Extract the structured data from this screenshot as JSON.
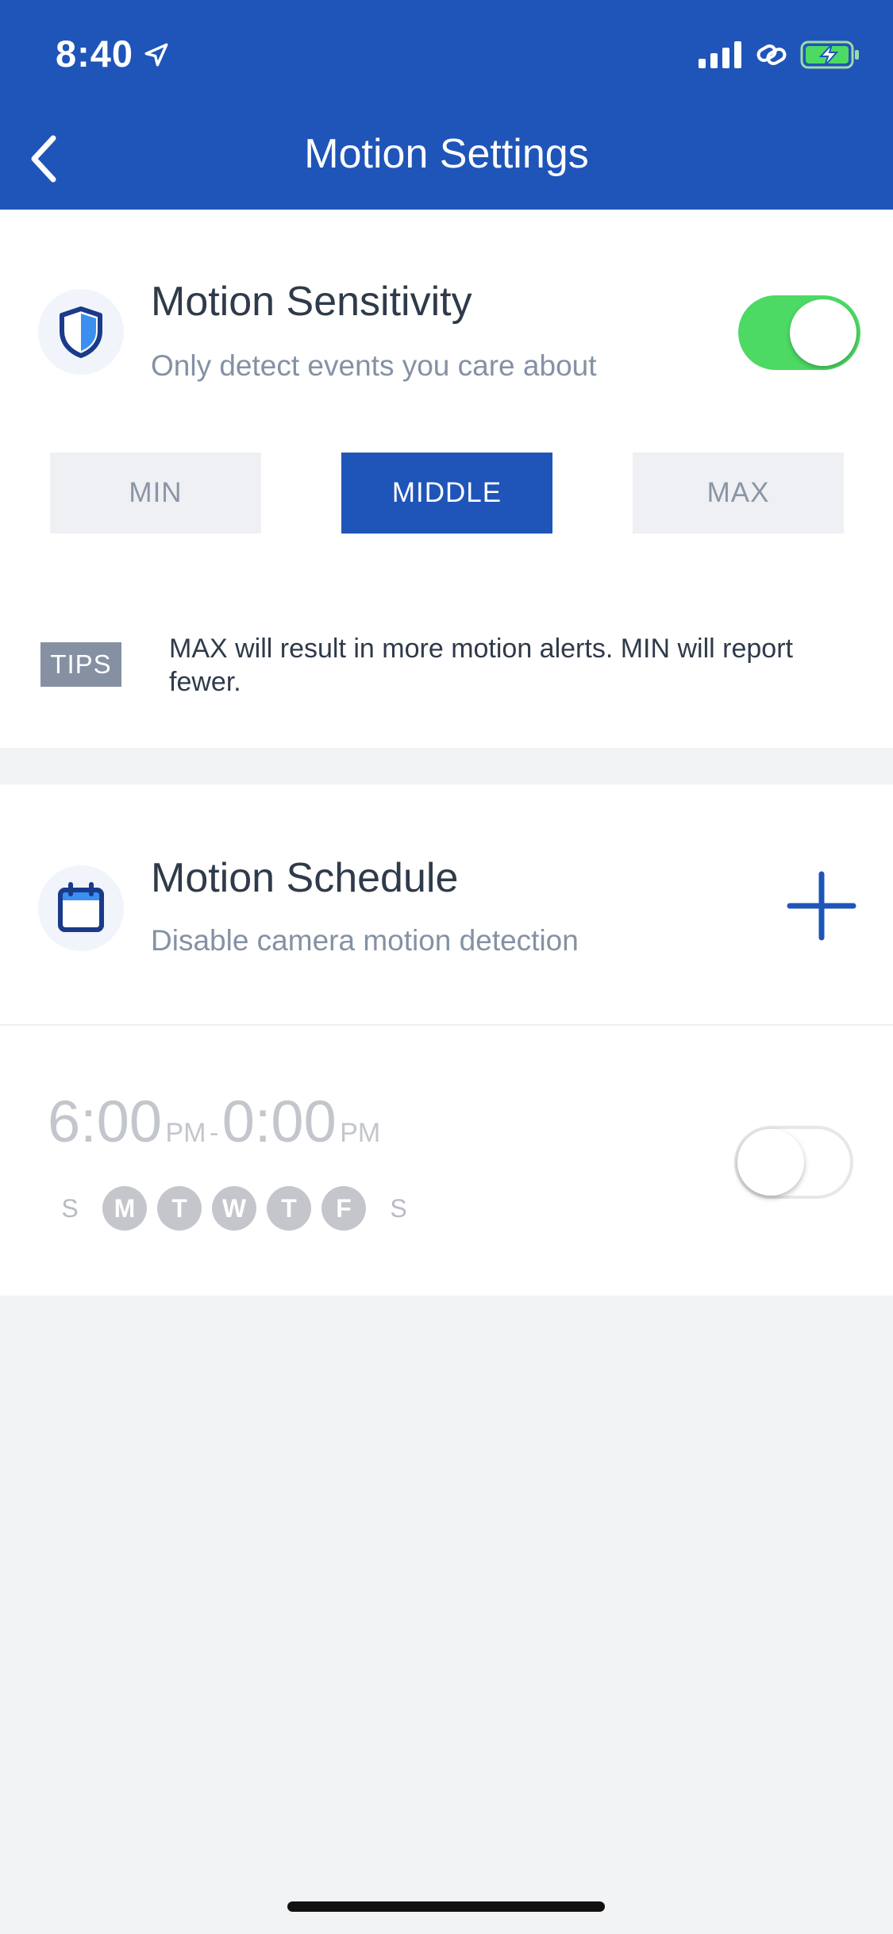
{
  "status_bar": {
    "time": "8:40"
  },
  "nav": {
    "title": "Motion Settings"
  },
  "sensitivity": {
    "title": "Motion Sensitivity",
    "subtitle": "Only detect events you care about",
    "enabled": true,
    "options": [
      "MIN",
      "MIDDLE",
      "MAX"
    ],
    "selected": "MIDDLE",
    "tips_label": "TIPS",
    "tips_text": "MAX will result in more motion alerts. MIN will report fewer."
  },
  "schedule": {
    "title": "Motion Schedule",
    "subtitle": "Disable camera motion detection",
    "entry": {
      "start_time": "6:00",
      "start_period": "PM",
      "separator": "-",
      "end_time": "0:00",
      "end_period": "PM",
      "days": [
        "S",
        "M",
        "T",
        "W",
        "T",
        "F",
        "S"
      ],
      "days_active": [
        false,
        true,
        true,
        true,
        true,
        true,
        false
      ],
      "enabled": false
    }
  },
  "colors": {
    "header_bg": "#1f55b8",
    "accent": "#1f55b8",
    "toggle_on": "#4cd964",
    "page_bg": "#f2f3f5"
  },
  "icons": [
    "back-chevron-icon",
    "location-arrow-icon",
    "signal-icon",
    "link-icon",
    "battery-charging-icon",
    "shield-icon",
    "calendar-icon",
    "plus-icon"
  ]
}
